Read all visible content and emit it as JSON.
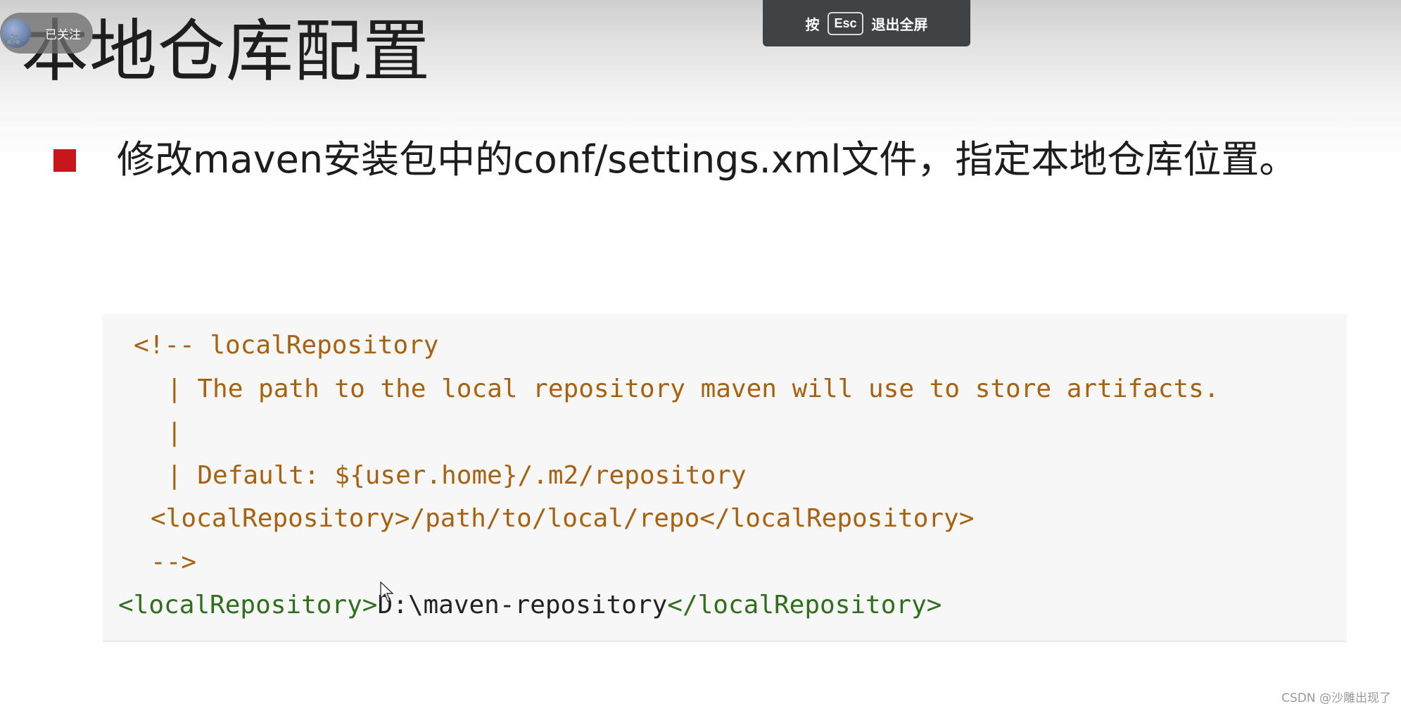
{
  "slide": {
    "title": "本地仓库配置",
    "bullet": "修改maven安装包中的conf/settings.xml文件，指定本地仓库位置。"
  },
  "overlay": {
    "follow_label": "已关注",
    "esc_prefix": "按",
    "esc_key": "Esc",
    "esc_suffix": "退出全屏"
  },
  "code": {
    "line1": "<!-- localRepository",
    "line2": "| The path to the local repository maven will use to store artifacts.",
    "line3": "|",
    "line4": "| Default: ${user.home}/.m2/repository",
    "line5": "<localRepository>/path/to/local/repo</localRepository>",
    "line6": "-->",
    "line7_open": "<localRepository>",
    "line7_value": "D:\\maven-repository",
    "line7_close": "</localRepository>"
  },
  "watermark": "CSDN @沙雕出现了",
  "colors": {
    "bullet_square": "#c8161d",
    "comment": "#a8610f",
    "tag": "#2f6e1d",
    "esc_bar": "#3f4346"
  }
}
